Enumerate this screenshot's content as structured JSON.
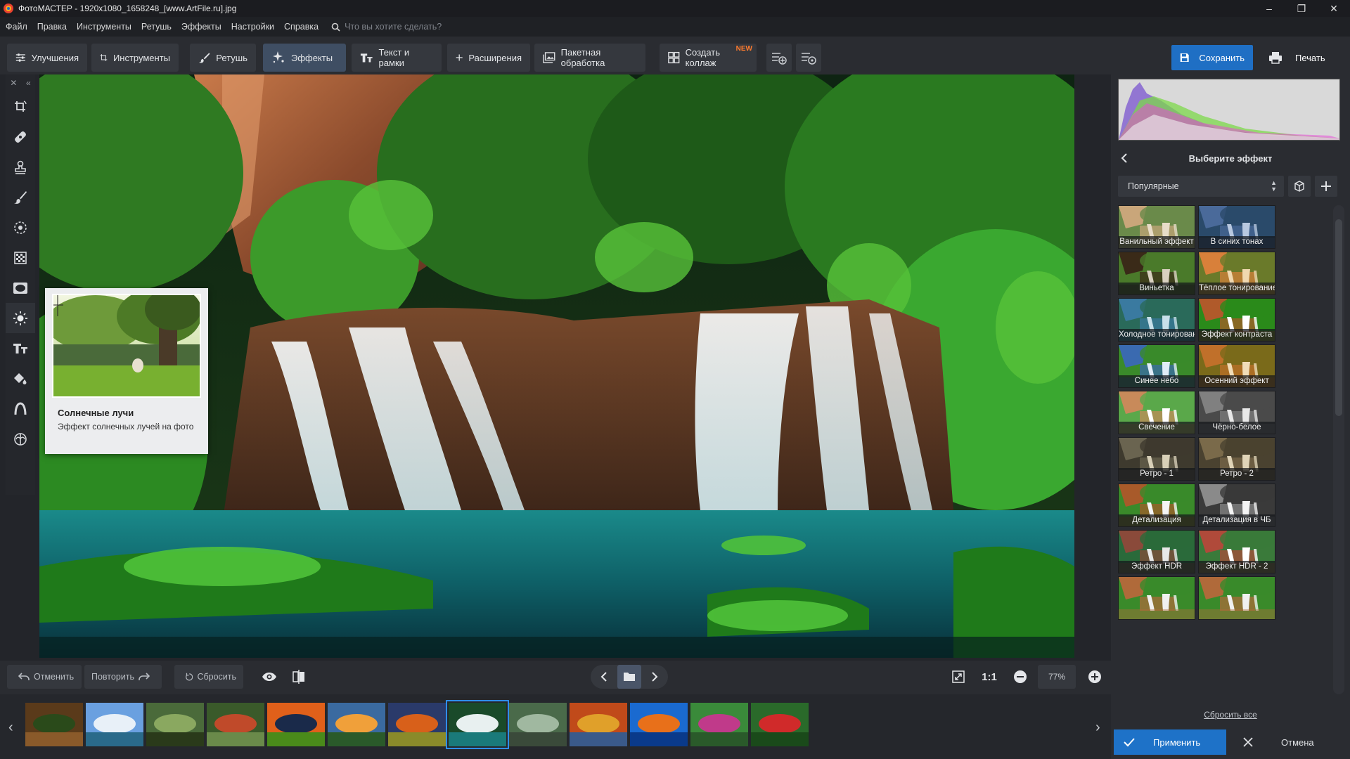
{
  "window": {
    "title": "ФотоМАСТЕР - 1920x1080_1658248_[www.ArtFile.ru].jpg",
    "controls": [
      "–",
      "❐",
      "✕"
    ]
  },
  "menu": {
    "items": [
      "Файл",
      "Правка",
      "Инструменты",
      "Ретушь",
      "Эффекты",
      "Настройки",
      "Справка"
    ],
    "search_placeholder": "Что вы хотите сделать?"
  },
  "toolbar": {
    "tabs": [
      {
        "label": "Улучшения",
        "icon": "sliders-icon"
      },
      {
        "label": "Инструменты",
        "icon": "crop-icon"
      },
      {
        "label": "Ретушь",
        "icon": "brush-icon"
      },
      {
        "label": "Эффекты",
        "icon": "sparkle-icon",
        "active": true
      },
      {
        "label": "Текст и рамки",
        "icon": "text-icon"
      },
      {
        "label": "Расширения",
        "icon": "plus-icon"
      }
    ],
    "batch_label": "Пакетная обработка",
    "collage_label": "Создать коллаж",
    "collage_badge": "NEW",
    "save_label": "Сохранить",
    "print_label": "Печать"
  },
  "tooltip": {
    "title": "Солнечные лучи",
    "description": "Эффект солнечных лучей на фото"
  },
  "effects_panel": {
    "heading": "Выберите эффект",
    "category": "Популярные",
    "effects": [
      {
        "label": "Ванильный эффект",
        "style": "vanilla"
      },
      {
        "label": "В синих тонах",
        "style": "blue"
      },
      {
        "label": "Виньетка",
        "style": "vignette"
      },
      {
        "label": "Тёплое тонирование",
        "style": "warm"
      },
      {
        "label": "Холодное тонирование",
        "style": "cold"
      },
      {
        "label": "Эффект контраста",
        "style": "contrast"
      },
      {
        "label": "Синее небо",
        "style": "sky"
      },
      {
        "label": "Осенний эффект",
        "style": "autumn"
      },
      {
        "label": "Свечение",
        "style": "glow"
      },
      {
        "label": "Чёрно-белое",
        "style": "bw"
      },
      {
        "label": "Ретро - 1",
        "style": "retro1"
      },
      {
        "label": "Ретро - 2",
        "style": "retro2"
      },
      {
        "label": "Детализация",
        "style": "detail"
      },
      {
        "label": "Детализация в ЧБ",
        "style": "detailbw"
      },
      {
        "label": "Эффект HDR",
        "style": "hdr"
      },
      {
        "label": "Эффект HDR - 2",
        "style": "hdr2"
      },
      {
        "label": "",
        "style": "normal"
      },
      {
        "label": "",
        "style": "normal"
      }
    ],
    "reset_all_label": "Сбросить все",
    "apply_label": "Применить",
    "cancel_label": "Отмена"
  },
  "bottom": {
    "undo_label": "Отменить",
    "redo_label": "Повторить",
    "reset_label": "Сбросить",
    "zoom_1to1": "1:1",
    "zoom_value": "77%"
  },
  "filmstrip": {
    "selected_index": 7,
    "thumbs": [
      "pinecones",
      "mountain-lake",
      "forest-path",
      "bridge",
      "sunset-field",
      "river-sunset",
      "autumn-field",
      "waterfall",
      "tree-house",
      "autumn-lake",
      "blue-lake",
      "flowers",
      "berries"
    ]
  },
  "colors": {
    "accent": "#1e72c8",
    "save_button": "#1f6fc4",
    "active_tab": "#3f4e63",
    "new_badge": "#ff7b2e",
    "selection": "#2e8ef0"
  }
}
